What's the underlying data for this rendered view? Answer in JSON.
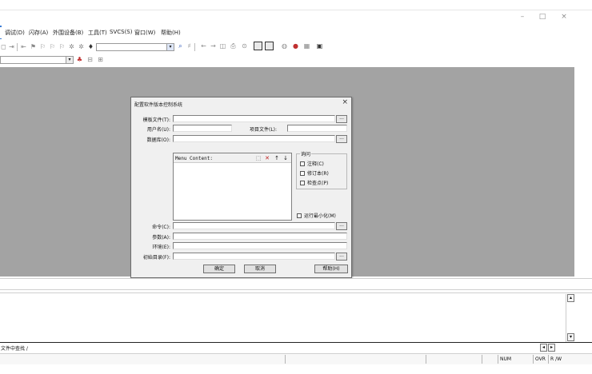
{
  "window": {
    "minimize_glyph": "–",
    "maximize_glyph": "□",
    "close_glyph": "×"
  },
  "menubar": {
    "items": [
      {
        "label": "调试(D)"
      },
      {
        "label": "闪存(A)"
      },
      {
        "label": "外围设备(B)"
      },
      {
        "label": "工具(T)"
      },
      {
        "label": "SVCS(S)"
      },
      {
        "label": "窗口(W)"
      },
      {
        "label": "帮助(H)"
      }
    ]
  },
  "toolbar": {
    "icons": [
      "save-icon",
      "indent-icon",
      "outdent-icon",
      "bookmark-icon",
      "bookmark-prev-icon",
      "bookmark-next-icon",
      "search-icon",
      "magic-icon",
      "find-icon",
      "back-icon",
      "forward-icon",
      "print-icon",
      "zoom-icon",
      "window-icon",
      "config-icon",
      "build-icon",
      "debug-icon",
      "settings-icon"
    ]
  },
  "dialog": {
    "title": "配置软件版本控制系统",
    "close_glyph": "×",
    "fields": {
      "template_file_label": "模板文件(T):",
      "template_file_value": "",
      "user_name_label": "用户名(U):",
      "user_name_value": "",
      "project_file_label": "项目文件(L):",
      "project_file_value": "",
      "database_label": "数据库(O):",
      "database_value": "",
      "command_label": "命令(C):",
      "command_value": "",
      "arguments_label": "参数(A):",
      "arguments_value": "",
      "env_label": "环境(E):",
      "env_value": "",
      "initial_folder_label": "初始目录(F):",
      "initial_folder_value": ""
    },
    "list": {
      "header": "Menu Content:"
    },
    "query_group": {
      "legend": "询问",
      "options": [
        {
          "label": "注释(C)",
          "checked": false
        },
        {
          "label": "修订本(R)",
          "checked": false
        },
        {
          "label": "检查点(P)",
          "checked": false
        }
      ]
    },
    "run_minimized_label": "运行最小化(M)",
    "run_minimized_checked": false,
    "buttons": {
      "ok": "确定",
      "cancel": "取消",
      "help": "帮助(H)"
    },
    "browse_label": "..."
  },
  "output": {
    "tab_label": "文件中查找 /"
  },
  "statusbar": {
    "num": "NUM",
    "ovr": "OVR",
    "rw": "R /W"
  }
}
